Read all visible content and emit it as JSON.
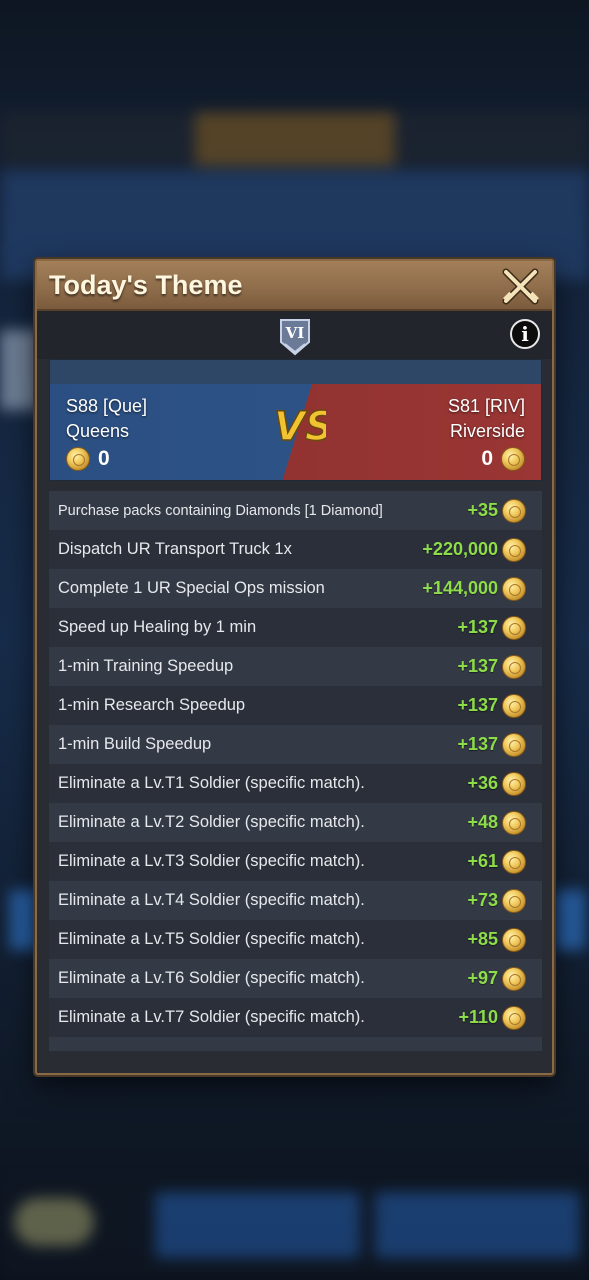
{
  "modal": {
    "title": "Today's Theme",
    "rank_badge": "VI",
    "info_icon": "info-icon",
    "close_icon": "crossed-swords-close-icon"
  },
  "vs": {
    "logo": "VS",
    "left": {
      "server": "S88 [Que]",
      "name": "Queens",
      "score": "0",
      "color": "#2b4f82"
    },
    "right": {
      "server": "S81 [RIV]",
      "name": "Riverside",
      "score": "0",
      "color": "#8a3030"
    }
  },
  "tasks": [
    {
      "label": "Purchase packs containing Diamonds [1 Diamond]",
      "points": "+35"
    },
    {
      "label": "Dispatch UR Transport Truck 1x",
      "points": "+220,000"
    },
    {
      "label": "Complete 1 UR Special Ops mission",
      "points": "+144,000"
    },
    {
      "label": "Speed up Healing by 1 min",
      "points": "+137"
    },
    {
      "label": "1-min Training Speedup",
      "points": "+137"
    },
    {
      "label": "1-min Research Speedup",
      "points": "+137"
    },
    {
      "label": "1-min Build Speedup",
      "points": "+137"
    },
    {
      "label": "Eliminate a Lv.T1 Soldier (specific match).",
      "points": "+36"
    },
    {
      "label": "Eliminate a Lv.T2 Soldier (specific match).",
      "points": "+48"
    },
    {
      "label": "Eliminate a Lv.T3 Soldier (specific match).",
      "points": "+61"
    },
    {
      "label": "Eliminate a Lv.T4 Soldier (specific match).",
      "points": "+73"
    },
    {
      "label": "Eliminate a Lv.T5 Soldier (specific match).",
      "points": "+85"
    },
    {
      "label": "Eliminate a Lv.T6 Soldier (specific match).",
      "points": "+97"
    },
    {
      "label": "Eliminate a Lv.T7 Soldier (specific match).",
      "points": "+110"
    }
  ],
  "colors": {
    "points_green": "#8ddc4a",
    "header_brown": "#8e6c4a",
    "coin_gold": "#f2cd62"
  }
}
